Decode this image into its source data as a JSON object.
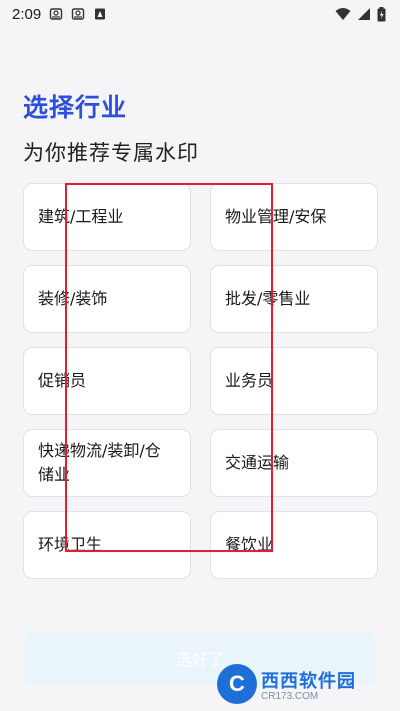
{
  "status_bar": {
    "time": "2:09"
  },
  "header": {
    "title": "选择行业",
    "subtitle": "为你推荐专属水印"
  },
  "industries": [
    "建筑/工程业",
    "物业管理/安保",
    "装修/装饰",
    "批发/零售业",
    "促销员",
    "业务员",
    "快递物流/装卸/仓储业",
    "交通运输",
    "环境卫生",
    "餐饮业"
  ],
  "footer": {
    "confirm_label": "选好了"
  },
  "watermark": {
    "main": "西西软件园",
    "sub": "CR173.COM"
  },
  "colors": {
    "accent": "#2d4fe0",
    "highlight": "#e02030",
    "button_bg": "#e9f4fb"
  }
}
